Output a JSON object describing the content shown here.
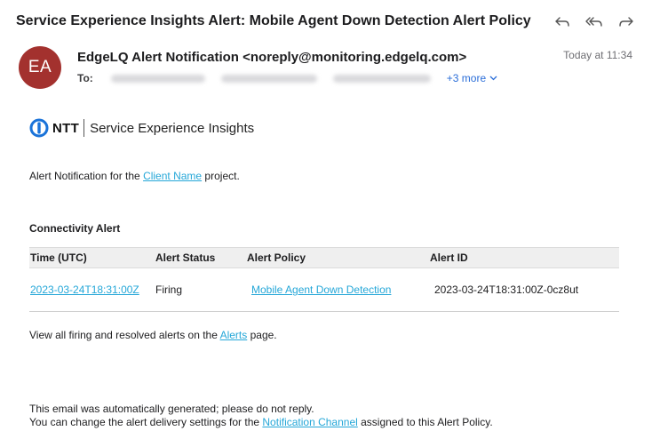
{
  "email": {
    "subject": "Service Experience Insights Alert: Mobile Agent Down Detection Alert Policy",
    "avatar_initials": "EA",
    "avatar_color": "#a3312e",
    "from": "EdgeLQ Alert Notification <noreply@monitoring.edgelq.com>",
    "date": "Today at 11:34",
    "to_label": "To:",
    "more_recipients": "+3 more"
  },
  "actions": [
    {
      "icon": "reply-icon"
    },
    {
      "icon": "reply-all-icon"
    },
    {
      "icon": "forward-icon"
    }
  ],
  "body": {
    "logo_brand": "NTT",
    "logo_product": "Service Experience Insights",
    "intro_prefix": "Alert Notification for the ",
    "intro_link": "Client Name",
    "intro_suffix": " project.",
    "section_title": "Connectivity Alert",
    "table": {
      "headers": [
        "Time (UTC)",
        "Alert Status",
        "Alert Policy",
        "Alert ID"
      ],
      "rows": [
        {
          "time": "2023-03-24T18:31:00Z",
          "status": "Firing",
          "policy": "Mobile Agent Down Detection",
          "id": "2023-03-24T18:31:00Z-0cz8ut"
        }
      ]
    },
    "view_prefix": "View all firing and resolved alerts on the ",
    "view_link": "Alerts",
    "view_suffix": " page.",
    "footer_line1": "This email was automatically generated; please do not reply.",
    "footer_prefix": "You can change the alert delivery settings for the ",
    "footer_link": "Notification Channel",
    "footer_suffix": " assigned to this Alert Policy."
  },
  "colors": {
    "link": "#25a7d8",
    "accent": "#2a6dd8",
    "logo_blue": "#1a73d9"
  }
}
